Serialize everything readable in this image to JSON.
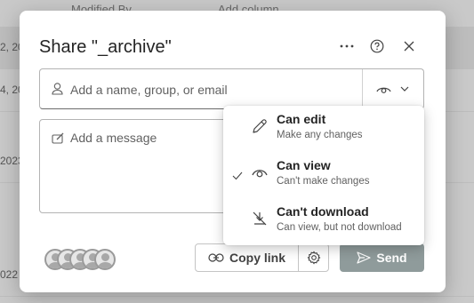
{
  "background": {
    "headers": [
      "Modified By",
      "Add column"
    ],
    "row_dates": [
      "2, 20",
      "4, 20",
      "2023",
      "022"
    ]
  },
  "dialog": {
    "title": "Share \"_archive\"",
    "header_icons": [
      "more-icon",
      "help-icon",
      "close-icon"
    ],
    "recipients": {
      "placeholder": "Add a name, group, or email",
      "value": ""
    },
    "message": {
      "placeholder": "Add a message",
      "value": ""
    },
    "copy_link_label": "Copy link",
    "send_label": "Send",
    "avatar_count": 5
  },
  "permission_menu": {
    "selected": "Can view",
    "items": [
      {
        "label": "Can edit",
        "description": "Make any changes",
        "icon": "pencil-icon",
        "checked": false
      },
      {
        "label": "Can view",
        "description": "Can't make changes",
        "icon": "eye-icon",
        "checked": true
      },
      {
        "label": "Can't download",
        "description": "Can view, but not download",
        "icon": "no-download-icon",
        "checked": false
      }
    ]
  },
  "colors": {
    "send_button": "#8f9b9b",
    "text_primary": "#242424",
    "text_secondary": "#616161"
  }
}
